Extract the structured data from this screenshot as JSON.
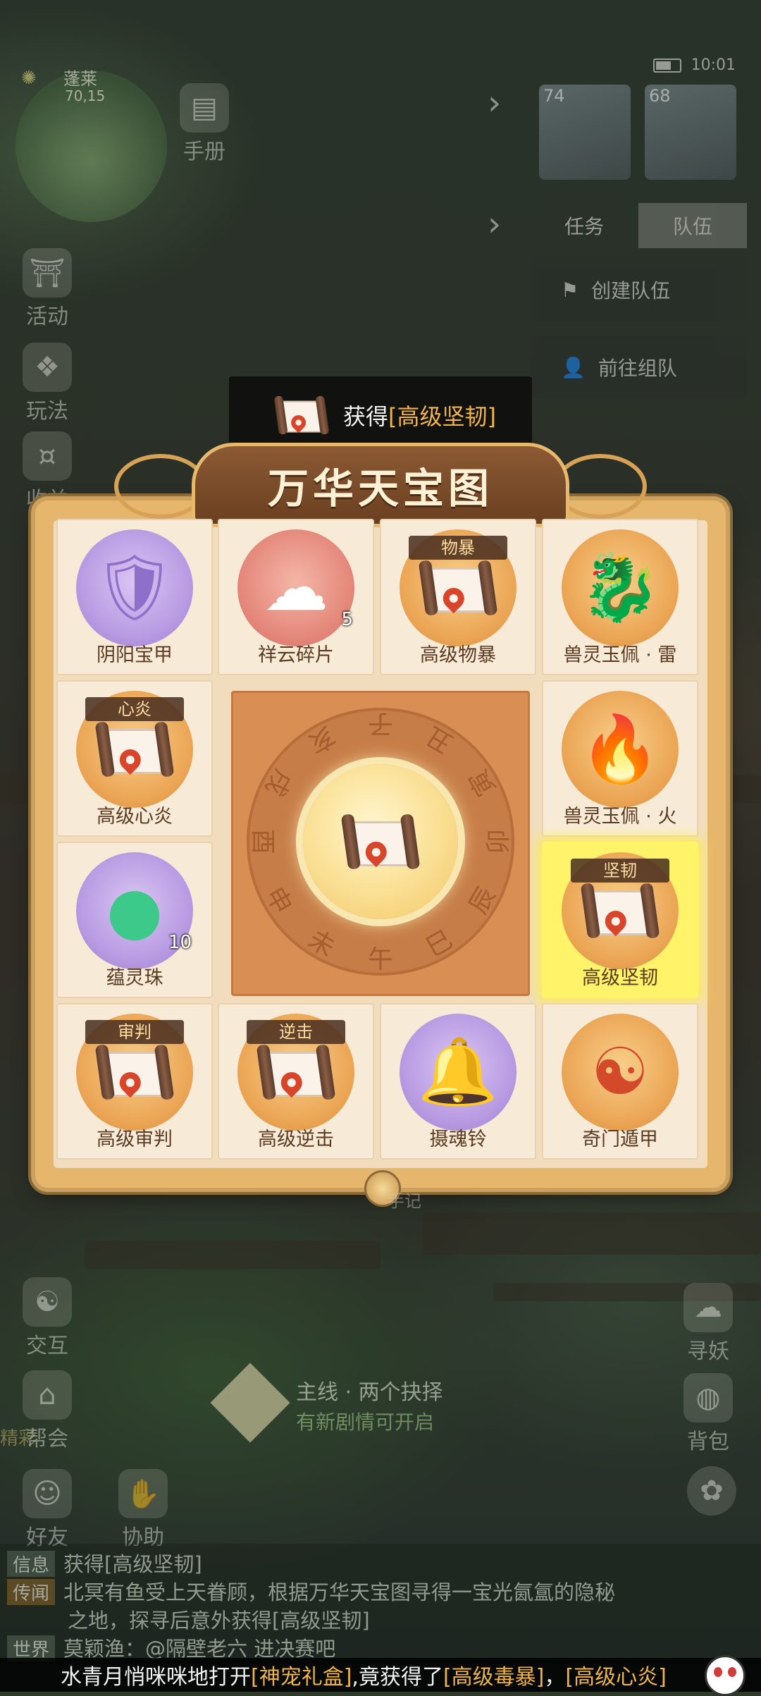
{
  "hud": {
    "map_name": "蓬莱",
    "map_coord": "70,15",
    "time": "10:01",
    "handbook_label": "手册",
    "party": [
      {
        "level": "74"
      },
      {
        "level": "68"
      }
    ],
    "team_panel": {
      "tabs": [
        "任务",
        "队伍"
      ],
      "active_tab": "队伍",
      "create_team": "创建队伍",
      "find_team": "前往组队"
    },
    "left_menu": [
      "活动",
      "玩法",
      "收益"
    ],
    "bottom_left": [
      "交互",
      "帮会",
      "好友",
      "协助"
    ],
    "bottom_left_extra": "精彩",
    "right_menu": [
      "寻妖",
      "背包"
    ],
    "quest": {
      "title": "主线 · 两个抉择",
      "subtitle": "有新剧情可开启"
    },
    "bag_note": "手记"
  },
  "toast": {
    "prefix": "获得",
    "item": "[高级坚韧]"
  },
  "panel": {
    "title": "万华天宝图",
    "cells": [
      {
        "name": "阴阳宝甲",
        "badge": "",
        "count": "",
        "icon": "purple-armor-icon",
        "bg": "purple",
        "highlight": false
      },
      {
        "name": "祥云碎片",
        "badge": "",
        "count": "5",
        "icon": "cloud-puzzle-icon",
        "bg": "red",
        "highlight": false
      },
      {
        "name": "高级物暴",
        "badge": "物暴",
        "count": "",
        "icon": "scroll-icon",
        "bg": "orange",
        "highlight": false
      },
      {
        "name": "兽灵玉佩 · 雷",
        "badge": "",
        "count": "",
        "icon": "purple-dragon-pendant-icon",
        "bg": "orange",
        "highlight": false
      },
      {
        "name": "高级心炎",
        "badge": "心炎",
        "count": "",
        "icon": "scroll-icon",
        "bg": "orange",
        "highlight": false
      },
      {
        "name": "兽灵玉佩 · 火",
        "badge": "",
        "count": "",
        "icon": "fire-dragon-pendant-icon",
        "bg": "orange",
        "highlight": false
      },
      {
        "name": "蕴灵珠",
        "badge": "",
        "count": "10",
        "icon": "green-orb-icon",
        "bg": "purple",
        "highlight": false
      },
      {
        "name": "高级坚韧",
        "badge": "坚韧",
        "count": "",
        "icon": "scroll-icon",
        "bg": "orange",
        "highlight": true
      },
      {
        "name": "高级审判",
        "badge": "审判",
        "count": "",
        "icon": "scroll-icon",
        "bg": "orange",
        "highlight": false
      },
      {
        "name": "高级逆击",
        "badge": "逆击",
        "count": "",
        "icon": "scroll-icon",
        "bg": "orange",
        "highlight": false
      },
      {
        "name": "摄魂铃",
        "badge": "",
        "count": "",
        "icon": "soul-bell-icon",
        "bg": "purple",
        "highlight": false
      },
      {
        "name": "奇门遁甲",
        "badge": "",
        "count": "",
        "icon": "taiji-book-icon",
        "bg": "orange",
        "highlight": false
      }
    ],
    "wheel_characters": [
      "子",
      "丑",
      "寅",
      "卯",
      "辰",
      "巳",
      "午",
      "未",
      "申",
      "酉",
      "戌",
      "亥"
    ]
  },
  "chat": {
    "lines": [
      {
        "tag": "信息",
        "text": "获得[高级坚韧]"
      },
      {
        "tag": "传闻",
        "text": "北冥有鱼受上天眷顾，根据万华天宝图寻得一宝光氤氲的隐秘"
      },
      {
        "tag": "",
        "text": "之地，探寻后意外获得[高级坚韧]"
      },
      {
        "tag": "世界",
        "text": "莫颖渔：@隔壁老六 进决赛吧"
      }
    ],
    "marquee": {
      "a": "水青月悄咪咪地打开",
      "b": "[神宠礼盒]",
      "c": ",竟获得了",
      "d": "[高级毒暴]",
      "e": "，",
      "f": "[高级心炎]"
    }
  },
  "colors": {
    "accent_gold": "#f0b54a",
    "highlight": "#fff36a",
    "panel": "#e6b66c"
  }
}
